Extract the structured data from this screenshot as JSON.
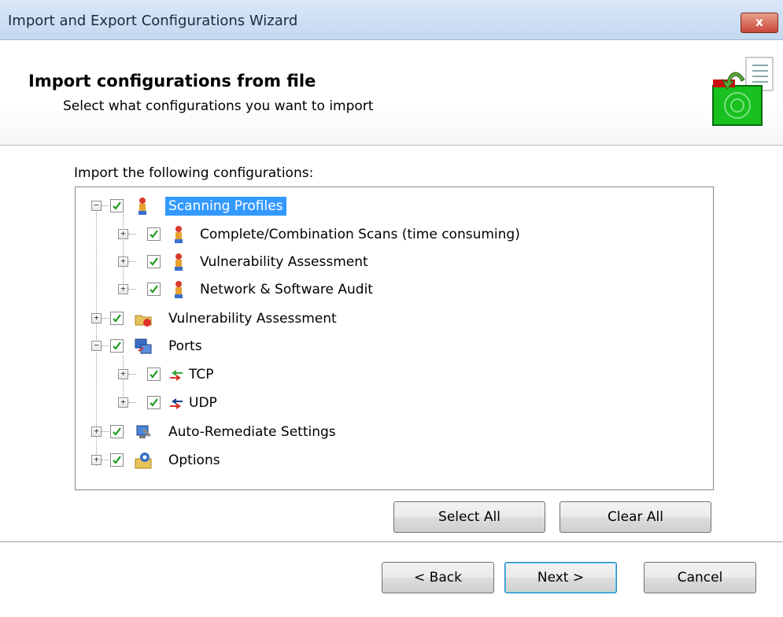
{
  "window": {
    "title": "Import and Export Configurations Wizard",
    "close_glyph": "x"
  },
  "header": {
    "title": "Import configurations from file",
    "subtitle": "Select what configurations you want to import"
  },
  "list_caption": "Import the following configurations:",
  "tree": {
    "nodes": [
      {
        "label": "Scanning Profiles",
        "checked": true,
        "expanded": true,
        "selected": true,
        "icon": "scan-profile-icon"
      },
      {
        "label": "Complete/Combination Scans (time consuming)",
        "checked": true,
        "expanded": false,
        "icon": "scan-profile-icon"
      },
      {
        "label": "Vulnerability Assessment",
        "checked": true,
        "expanded": false,
        "icon": "scan-profile-icon"
      },
      {
        "label": "Network & Software Audit",
        "checked": true,
        "expanded": false,
        "icon": "scan-profile-icon"
      },
      {
        "label": "Vulnerability Assessment",
        "checked": true,
        "expanded": false,
        "icon": "vulnerability-icon"
      },
      {
        "label": "Ports",
        "checked": true,
        "expanded": true,
        "icon": "ports-icon"
      },
      {
        "label": "TCP",
        "checked": true,
        "expanded": false,
        "icon": "tcp-arrows-icon"
      },
      {
        "label": "UDP",
        "checked": true,
        "expanded": false,
        "icon": "udp-arrows-icon"
      },
      {
        "label": "Auto-Remediate Settings",
        "checked": true,
        "expanded": false,
        "icon": "auto-remediate-icon"
      },
      {
        "label": "Options",
        "checked": true,
        "expanded": false,
        "icon": "options-gear-icon"
      }
    ]
  },
  "buttons": {
    "select_all": "Select All",
    "clear_all": "Clear All",
    "back": "< Back",
    "next": "Next >",
    "cancel": "Cancel"
  },
  "colors": {
    "selection": "#3399ff",
    "check": "#1c9c1c",
    "title_bar": "#c4d8ef"
  }
}
